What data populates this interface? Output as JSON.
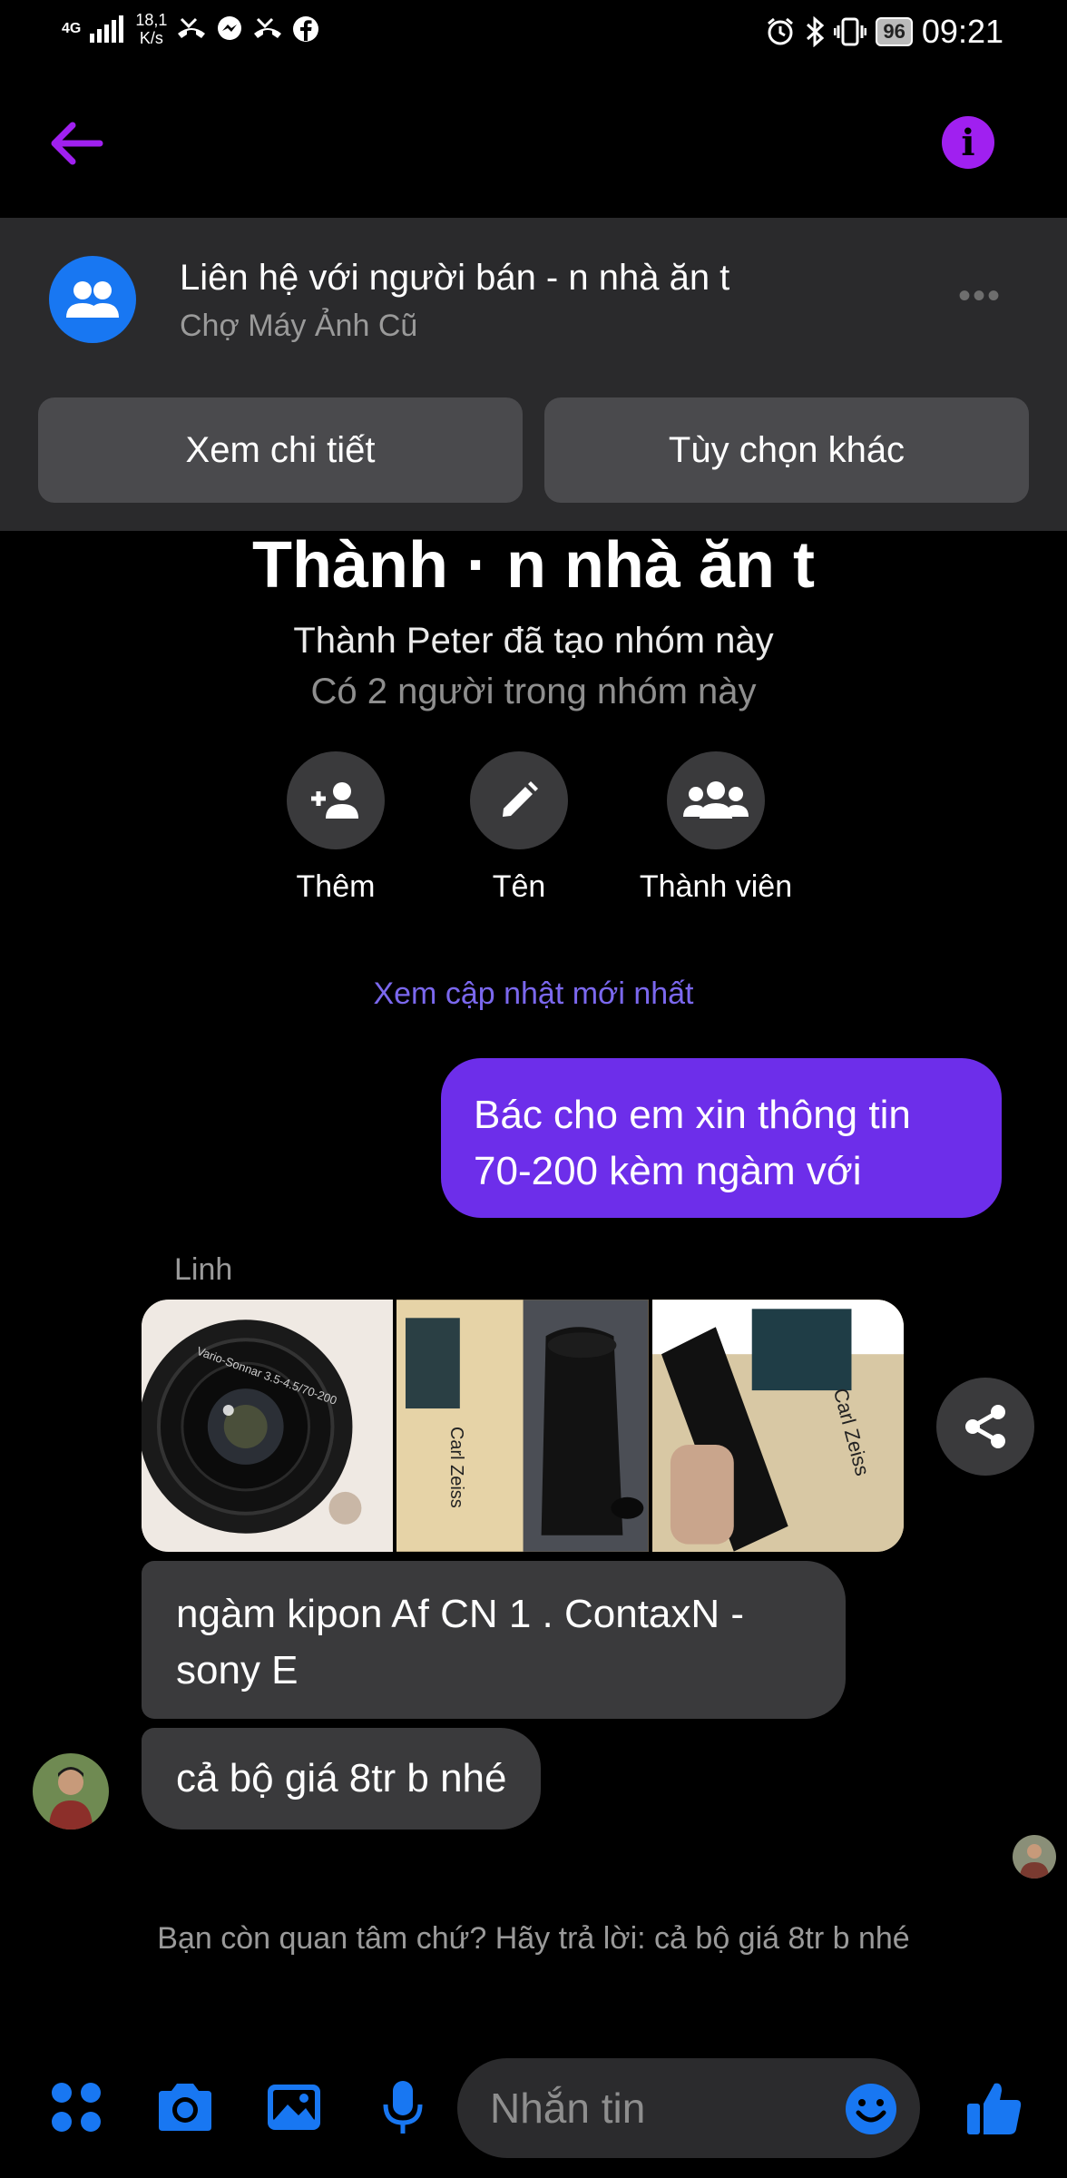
{
  "status_bar": {
    "network": "4G",
    "speed_value": "18,1",
    "speed_unit": "K/s",
    "battery": "96",
    "time": "09:21"
  },
  "banner": {
    "title": "Liên hệ với người bán - n nhà ăn t",
    "subtitle": "Chợ Máy Ảnh Cũ",
    "more": "•••",
    "btn_details": "Xem chi tiết",
    "btn_options": "Tùy chọn khác"
  },
  "group": {
    "title": "Thành · n nhà ăn t",
    "created": "Thành Peter đã tạo nhóm này",
    "count": "Có 2 người trong nhóm này",
    "actions": [
      {
        "label": "Thêm",
        "icon": "add-person-icon"
      },
      {
        "label": "Tên",
        "icon": "pencil-icon"
      },
      {
        "label": "Thành viên",
        "icon": "group-icon"
      }
    ]
  },
  "see_updates": "Xem cập nhật mới nhất",
  "messages": {
    "outgoing": "Bác cho em xin thông tin 70-200 kèm ngàm với",
    "sender": "Linh",
    "photos": [
      {
        "icon": "lens-photo",
        "text": "Vario-Sonnar 3.5-4.5/70-200"
      },
      {
        "icon": "box-bag-photo",
        "text": "Carl Zeiss"
      },
      {
        "icon": "lens-box-photo",
        "text": "Carl Zeiss"
      }
    ],
    "incoming_1": "ngàm kipon Af CN 1 . ContaxN - sony E",
    "incoming_2": "cả bộ giá 8tr b nhé"
  },
  "suggestion": "Bạn còn quan tâm chứ? Hãy trả lời: cả bộ giá 8tr b nhé",
  "composer": {
    "placeholder": "Nhắn tin"
  },
  "colors": {
    "accent": "#a020f0",
    "outgoing_bubble": "#6d2eea",
    "incoming_bubble": "#3a3a3c",
    "composer_blue": "#1877f2"
  }
}
